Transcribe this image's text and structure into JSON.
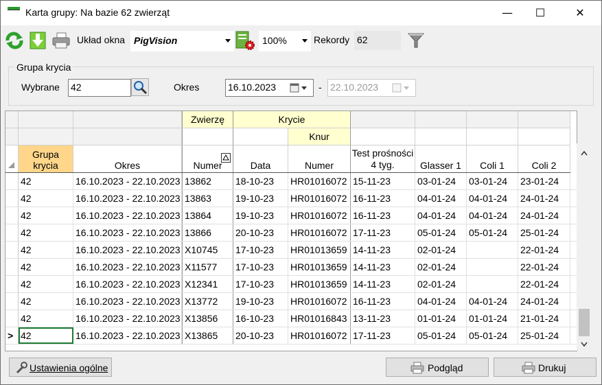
{
  "window": {
    "title": "Karta grupy: Na bazie 62 zwierząt",
    "minimize": "—",
    "maximize": "☐",
    "close": "✕"
  },
  "toolbar": {
    "layout_label": "Układ okna",
    "layout_value": "PigVision",
    "zoom_value": "100%",
    "records_label": "Rekordy",
    "records_value": "62"
  },
  "filter": {
    "group_title": "Grupa krycia",
    "selected_label": "Wybrane",
    "selected_value": "42",
    "period_label": "Okres",
    "date_from": "16.10.2023",
    "dash": "-",
    "date_to": "22.10.2023"
  },
  "grid": {
    "band_zwierze": "Zwierzę",
    "band_krycie": "Krycie",
    "band_knur": "Knur",
    "columns": [
      "Grupa krycia",
      "Okres",
      "Numer",
      "Data",
      "Numer",
      "Test prośności 4 tyg.",
      "Glasser 1",
      "Coli 1",
      "Coli 2"
    ],
    "rows": [
      {
        "grupa": "42",
        "okres": "16.10.2023 - 22.10.2023",
        "numer": "13862",
        "data": "18-10-23",
        "knur": "HR01016072",
        "test": "15-11-23",
        "glasser": "03-01-24",
        "coli1": "03-01-24",
        "coli2": "23-01-24"
      },
      {
        "grupa": "42",
        "okres": "16.10.2023 - 22.10.2023",
        "numer": "13863",
        "data": "19-10-23",
        "knur": "HR01016072",
        "test": "16-11-23",
        "glasser": "04-01-24",
        "coli1": "04-01-24",
        "coli2": "24-01-24"
      },
      {
        "grupa": "42",
        "okres": "16.10.2023 - 22.10.2023",
        "numer": "13864",
        "data": "19-10-23",
        "knur": "HR01016072",
        "test": "16-11-23",
        "glasser": "04-01-24",
        "coli1": "04-01-24",
        "coli2": "24-01-24"
      },
      {
        "grupa": "42",
        "okres": "16.10.2023 - 22.10.2023",
        "numer": "13866",
        "data": "20-10-23",
        "knur": "HR01016072",
        "test": "17-11-23",
        "glasser": "05-01-24",
        "coli1": "05-01-24",
        "coli2": "25-01-24"
      },
      {
        "grupa": "42",
        "okres": "16.10.2023 - 22.10.2023",
        "numer": "X10745",
        "data": "17-10-23",
        "knur": "HR01013659",
        "test": "14-11-23",
        "glasser": "02-01-24",
        "coli1": "",
        "coli2": "22-01-24"
      },
      {
        "grupa": "42",
        "okres": "16.10.2023 - 22.10.2023",
        "numer": "X11577",
        "data": "17-10-23",
        "knur": "HR01013659",
        "test": "14-11-23",
        "glasser": "02-01-24",
        "coli1": "",
        "coli2": "22-01-24"
      },
      {
        "grupa": "42",
        "okres": "16.10.2023 - 22.10.2023",
        "numer": "X12341",
        "data": "17-10-23",
        "knur": "HR01013659",
        "test": "14-11-23",
        "glasser": "02-01-24",
        "coli1": "",
        "coli2": "22-01-24"
      },
      {
        "grupa": "42",
        "okres": "16.10.2023 - 22.10.2023",
        "numer": "X13772",
        "data": "19-10-23",
        "knur": "HR01016072",
        "test": "16-11-23",
        "glasser": "04-01-24",
        "coli1": "04-01-24",
        "coli2": "24-01-24"
      },
      {
        "grupa": "42",
        "okres": "16.10.2023 - 22.10.2023",
        "numer": "X13856",
        "data": "16-10-23",
        "knur": "HR01016843",
        "test": "13-11-23",
        "glasser": "01-01-24",
        "coli1": "01-01-24",
        "coli2": "21-01-24"
      },
      {
        "grupa": "42",
        "okres": "16.10.2023 - 22.10.2023",
        "numer": "X13865",
        "data": "20-10-23",
        "knur": "HR01016072",
        "test": "17-11-23",
        "glasser": "05-01-24",
        "coli1": "05-01-24",
        "coli2": "25-01-24"
      }
    ],
    "current_row_marker": ">"
  },
  "buttons": {
    "settings": "Ustawienia ogólne",
    "preview": "Podgląd",
    "print": "Drukuj"
  },
  "colors": {
    "header_yellow": "#ffffd0",
    "group_col_orange": "#ffd68a",
    "selection_green": "#1e7b34"
  }
}
